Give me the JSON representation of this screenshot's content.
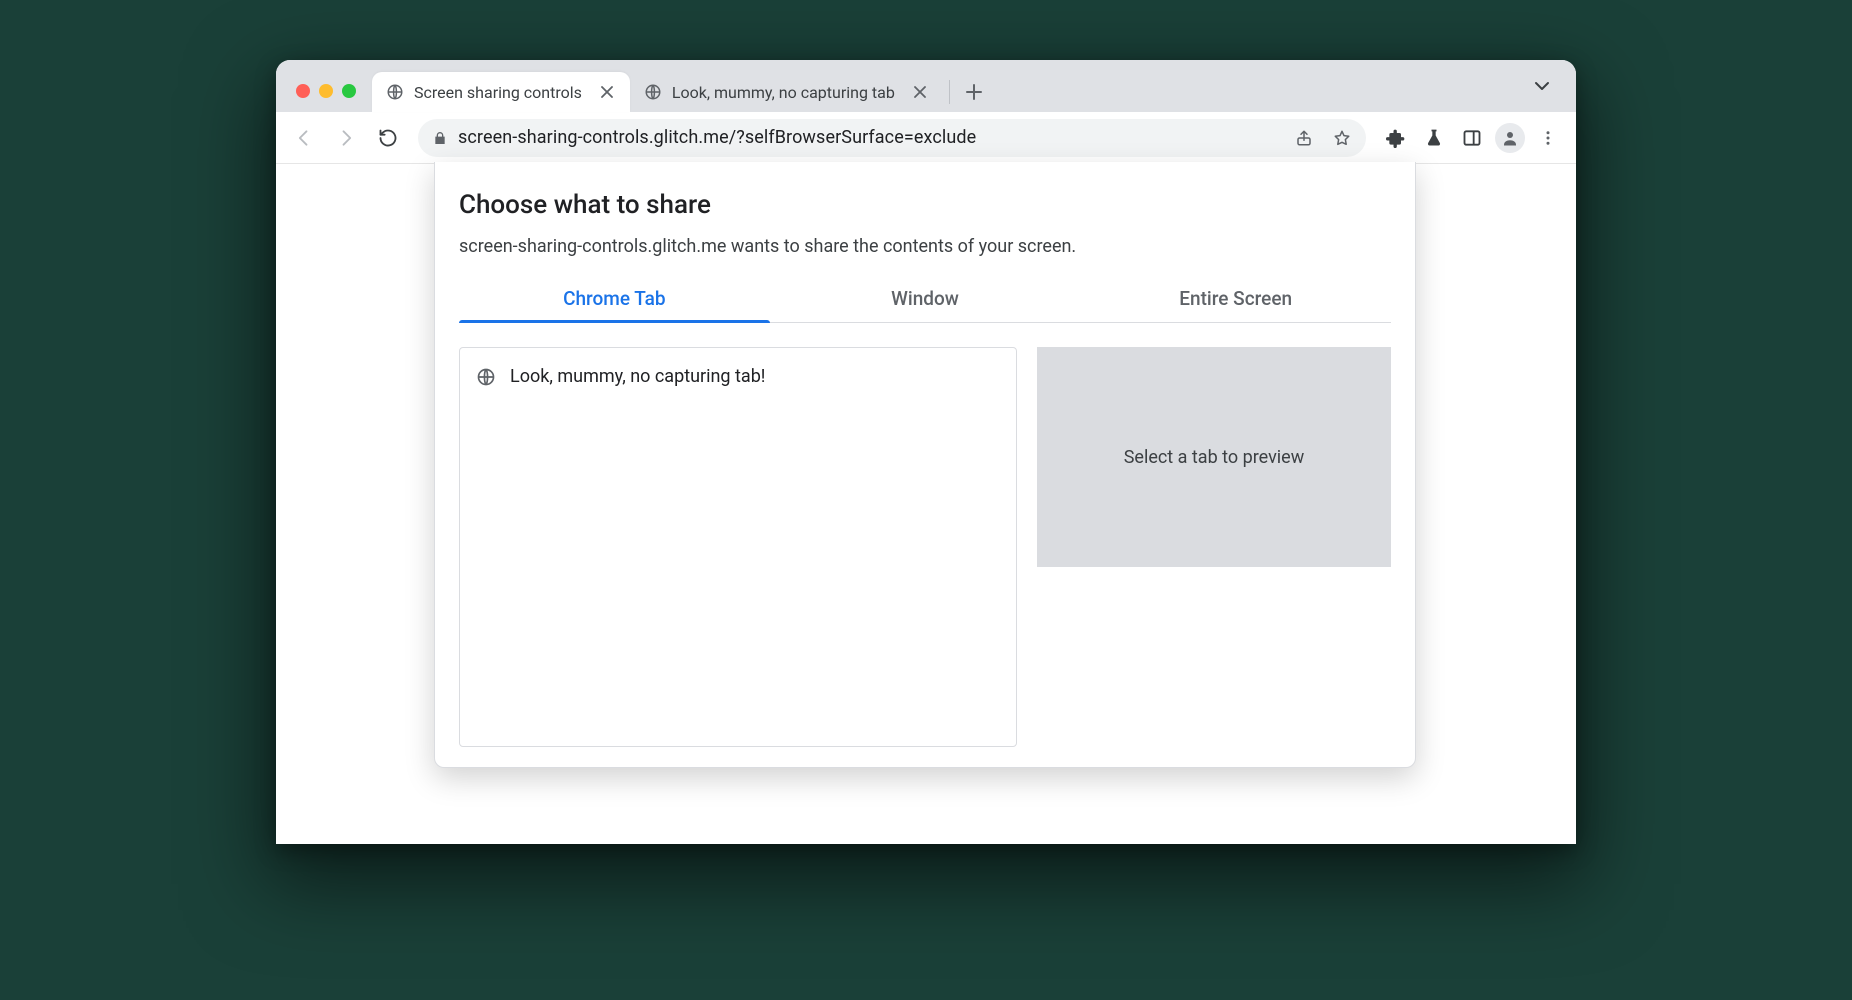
{
  "browser": {
    "tabs": [
      {
        "title": "Screen sharing controls",
        "active": true
      },
      {
        "title": "Look, mummy, no capturing tab",
        "active": false
      }
    ],
    "url": "screen-sharing-controls.glitch.me/?selfBrowserSurface=exclude"
  },
  "picker": {
    "title": "Choose what to share",
    "subtitle": "screen-sharing-controls.glitch.me wants to share the contents of your screen.",
    "tabs": {
      "chrome": "Chrome Tab",
      "window": "Window",
      "screen": "Entire Screen"
    },
    "active_tab": "chrome",
    "list": [
      {
        "title": "Look, mummy, no capturing tab!"
      }
    ],
    "preview_placeholder": "Select a tab to preview"
  }
}
